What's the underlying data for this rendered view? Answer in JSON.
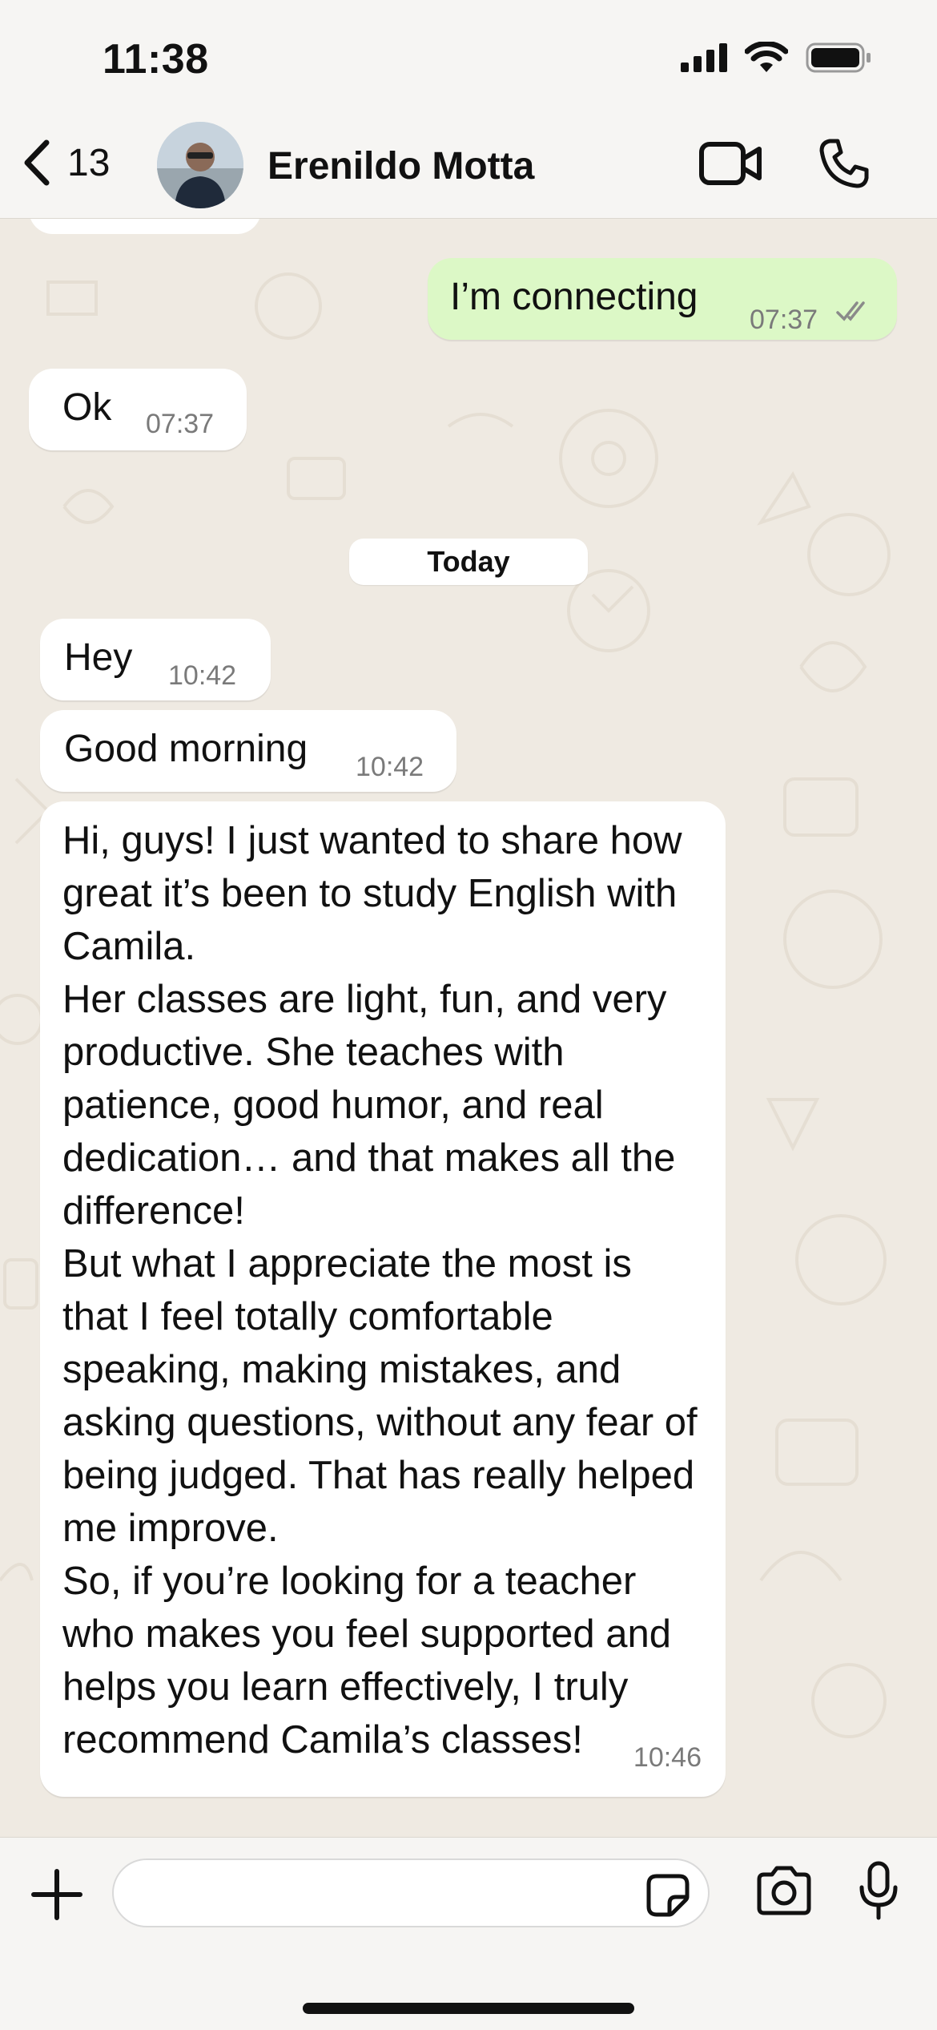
{
  "status_bar": {
    "time": "11:38"
  },
  "header": {
    "back_count": "13",
    "contact_name": "Erenildo Motta"
  },
  "chat": {
    "messages": [
      {
        "from": "me",
        "text": "I’m connecting",
        "time": "07:37",
        "status": "read"
      },
      {
        "from": "contact",
        "text": "Ok",
        "time": "07:37"
      },
      {
        "divider": "Today"
      },
      {
        "from": "contact",
        "text": "Hey",
        "time": "10:42"
      },
      {
        "from": "contact",
        "text": "Good morning",
        "time": "10:42"
      },
      {
        "from": "contact",
        "text": "Hi, guys! I just wanted to share how great it’s been to study English with Camila.\nHer classes are light, fun, and very productive. She teaches with patience, good humor, and real dedication… and that makes all the difference!\nBut what I appreciate the most is that I feel totally comfortable speaking, making mistakes, and asking questions, without any fear of being judged. That has really helped me improve.\nSo, if you’re looking for a teacher who makes you feel supported and helps you learn effectively, I truly recommend Camila’s classes!",
        "time": "10:46"
      }
    ]
  },
  "composer": {
    "placeholder": ""
  },
  "colors": {
    "wallpaper": "#efeae2",
    "outgoing_bubble": "#dcf8c6",
    "incoming_bubble": "#ffffff",
    "bars": "#f6f5f3"
  },
  "icons": [
    "back-chevron-icon",
    "video-call-icon",
    "phone-icon",
    "plus-icon",
    "sticker-icon",
    "camera-icon",
    "mic-icon",
    "double-check-icon",
    "signal-icon",
    "wifi-icon",
    "battery-icon"
  ]
}
